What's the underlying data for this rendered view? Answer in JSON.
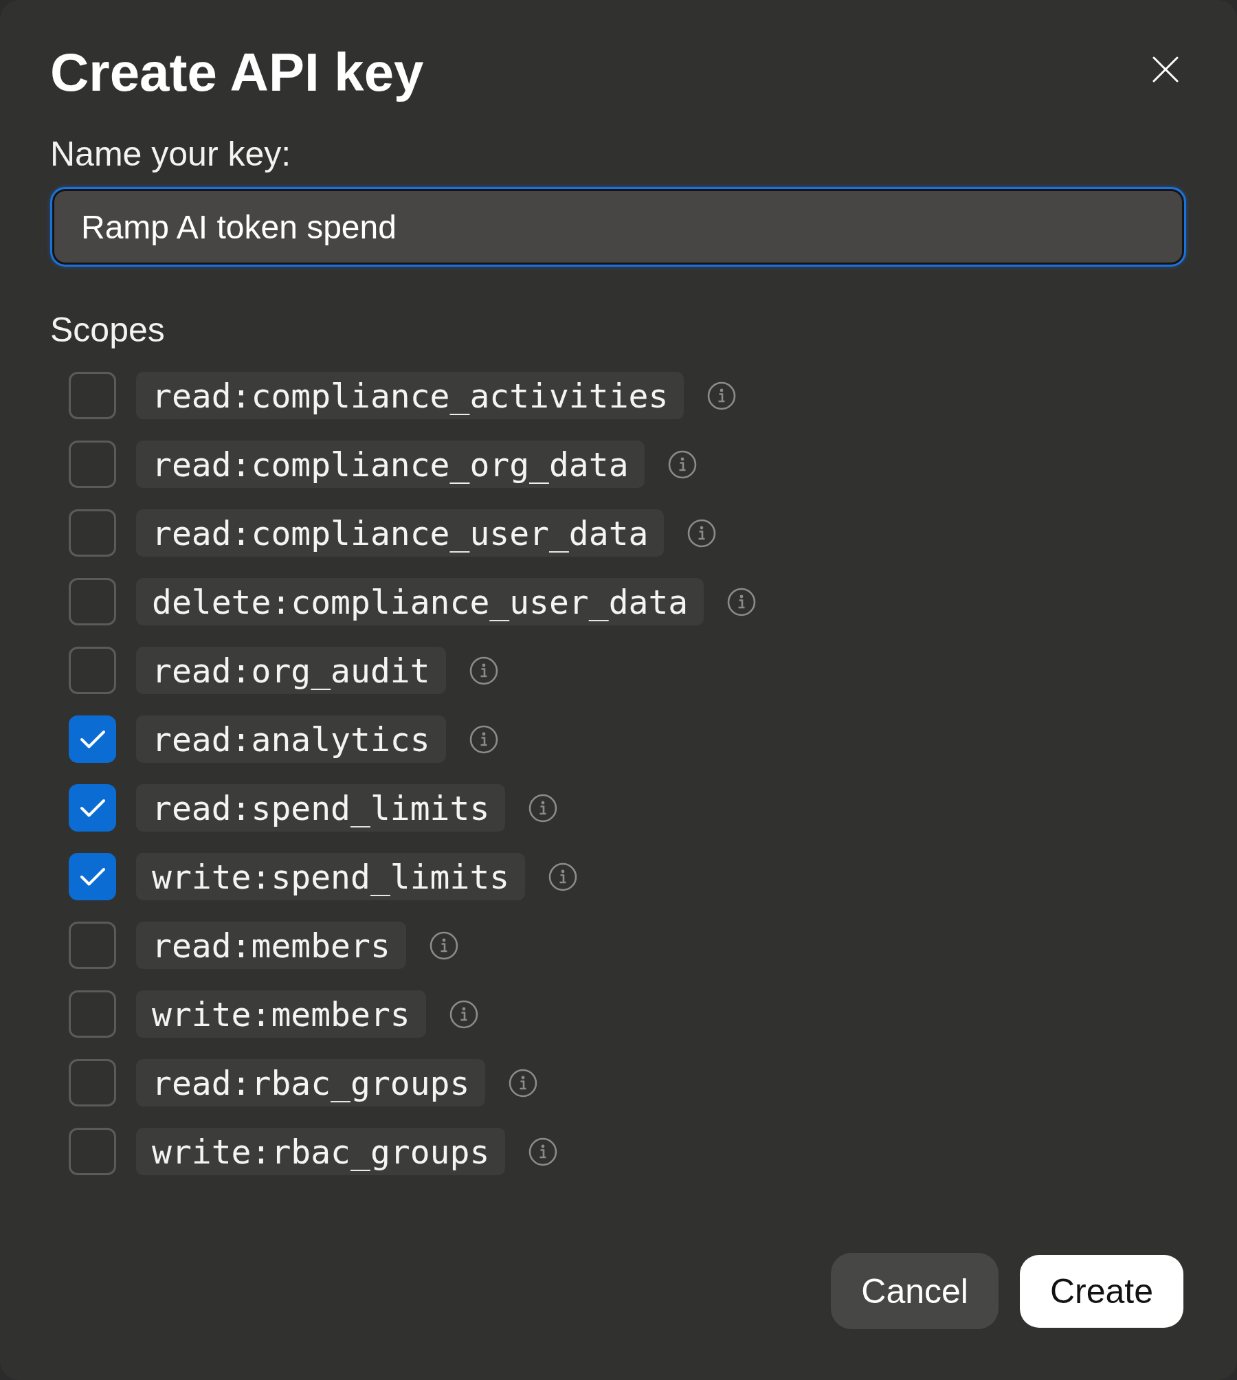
{
  "title": "Create API key",
  "name_field": {
    "label": "Name your key:",
    "value": "Ramp AI token spend",
    "focused": true
  },
  "scopes": {
    "heading": "Scopes",
    "items": [
      {
        "name": "read:compliance_activities",
        "checked": false
      },
      {
        "name": "read:compliance_org_data",
        "checked": false
      },
      {
        "name": "read:compliance_user_data",
        "checked": false
      },
      {
        "name": "delete:compliance_user_data",
        "checked": false
      },
      {
        "name": "read:org_audit",
        "checked": false
      },
      {
        "name": "read:analytics",
        "checked": true
      },
      {
        "name": "read:spend_limits",
        "checked": true
      },
      {
        "name": "write:spend_limits",
        "checked": true
      },
      {
        "name": "read:members",
        "checked": false
      },
      {
        "name": "write:members",
        "checked": false
      },
      {
        "name": "read:rbac_groups",
        "checked": false
      },
      {
        "name": "write:rbac_groups",
        "checked": false
      }
    ]
  },
  "buttons": [
    {
      "label": "Cancel",
      "kind": "secondary"
    },
    {
      "label": "Create",
      "kind": "primary"
    }
  ]
}
